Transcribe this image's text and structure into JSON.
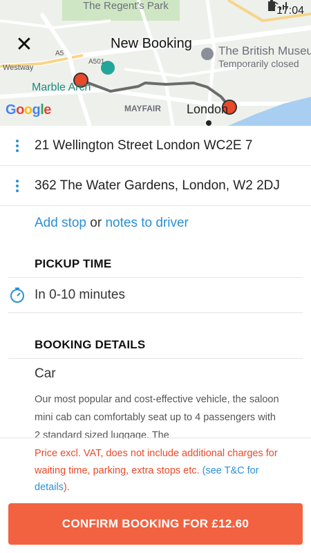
{
  "status_bar": {
    "time": "17:04"
  },
  "header": {
    "title": "New Booking"
  },
  "map": {
    "labels": {
      "regents_park": "The Regent's Park",
      "british_museum": "The British Museu",
      "temporarily_closed": "Temporarily closed",
      "marble_arch": "Marble Arch",
      "mayfair": "MAYFAIR",
      "london": "London",
      "westway": "Westway",
      "a5": "A5",
      "a501": "A501"
    },
    "attribution": "Google"
  },
  "addresses": {
    "pickup": "21 Wellington Street London WC2E 7",
    "dropoff": "362 The Water Gardens, London, W2 2DJ"
  },
  "extras": {
    "add_stop": "Add stop",
    "or": "or",
    "notes": "notes to driver"
  },
  "pickup_time": {
    "heading": "PICKUP TIME",
    "value": "In 0-10 minutes"
  },
  "booking_details": {
    "heading": "BOOKING DETAILS",
    "vehicle": "Car",
    "description": "Our most popular and cost-effective vehicle, the saloon mini cab can comfortably seat up to 4 passengers with 2 standard sized luggage. The"
  },
  "notice": {
    "text": "Price excl. VAT, does not include additional charges for waiting time, parking, extra stops etc.",
    "tc_open": "(",
    "tc_link": "see T&C for details",
    "tc_close": ")."
  },
  "confirm_button": {
    "label": "CONFIRM BOOKING FOR £12.60"
  },
  "colors": {
    "accent": "#f26240",
    "link": "#2a8fd6",
    "warning": "#e8492a"
  }
}
